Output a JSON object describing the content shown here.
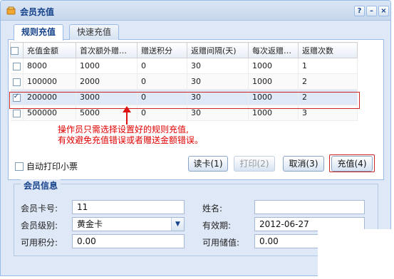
{
  "window": {
    "title": "会员充值",
    "controls": {
      "help": "?",
      "minimize": "–",
      "close": "×"
    }
  },
  "tabs": [
    {
      "label": "规则充值",
      "active": true
    },
    {
      "label": "快速充值",
      "active": false
    }
  ],
  "grid": {
    "headers": [
      "充值金额",
      "首次额外赠…",
      "赠送积分",
      "返赠间隔(天)",
      "每次返赠…",
      "返赠次数"
    ],
    "rows": [
      {
        "checked": false,
        "cells": [
          "8000",
          "1000",
          "0",
          "30",
          "1000",
          "1"
        ]
      },
      {
        "checked": false,
        "cells": [
          "100000",
          "2000",
          "0",
          "30",
          "1000",
          "2"
        ]
      },
      {
        "checked": true,
        "cells": [
          "200000",
          "3000",
          "0",
          "30",
          "1000",
          "2"
        ]
      },
      {
        "checked": false,
        "cells": [
          "500000",
          "5000",
          "0",
          "30",
          "1000",
          "3"
        ]
      }
    ]
  },
  "annotation": {
    "line1": "操作员只需选择设置好的规则充值,",
    "line2": "有效避免充值错误或者赠送金额错误。"
  },
  "actions": {
    "auto_print_label": "自动打印小票",
    "read_card": "读卡(1)",
    "print": "打印(2)",
    "cancel": "取消(3)",
    "recharge": "充值(4)"
  },
  "member_info": {
    "legend": "会员信息",
    "card_no_label": "会员卡号:",
    "card_no": "11",
    "name_label": "姓名:",
    "name": "",
    "level_label": "会员级别:",
    "level": "黄金卡",
    "expiry_label": "有效期:",
    "expiry": "2012-06-27",
    "points_label": "可用积分:",
    "points": "0.00",
    "balance_label": "可用储值:",
    "balance": "0.00"
  },
  "colors": {
    "accent": "#15428b",
    "highlight_red": "#cc2222",
    "panel_bg": "#dfe8f6"
  }
}
